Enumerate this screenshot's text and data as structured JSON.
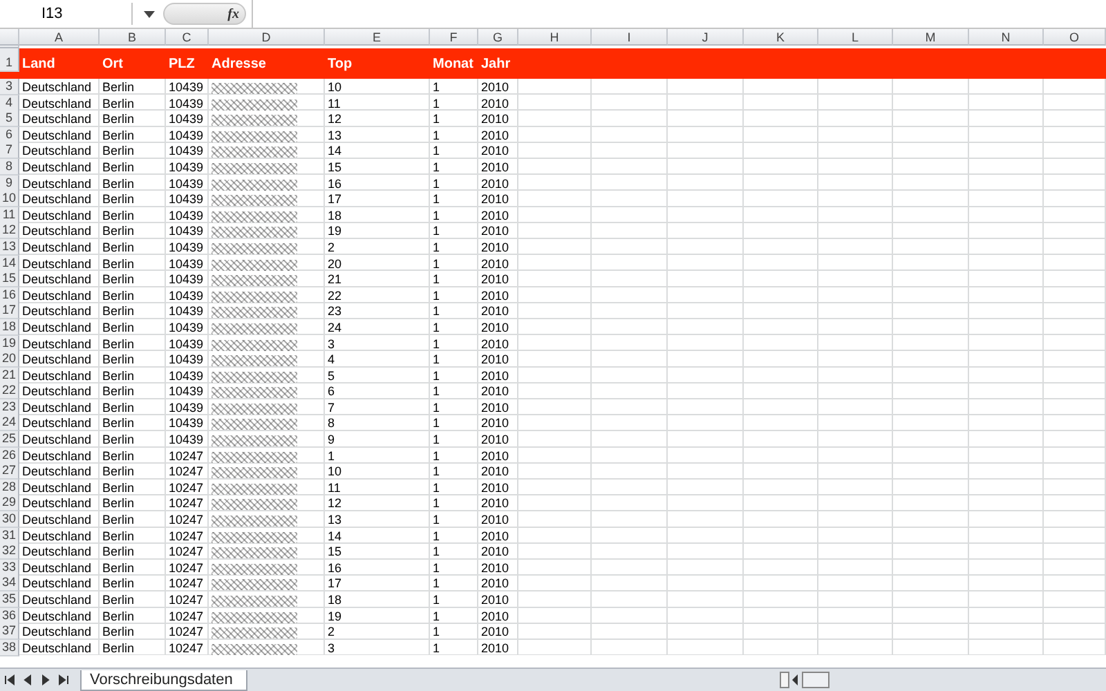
{
  "formula_bar": {
    "name_box": "I13",
    "function_label": "fx"
  },
  "columns": [
    "A",
    "B",
    "C",
    "D",
    "E",
    "F",
    "G",
    "H",
    "I",
    "J",
    "K",
    "L",
    "M",
    "N",
    "O"
  ],
  "header_row": {
    "row": "1",
    "cells": [
      "Land",
      "Ort",
      "PLZ",
      "Adresse",
      "Top",
      "Monat",
      "Jahr"
    ]
  },
  "rows": [
    {
      "row": "3",
      "cells": [
        "Deutschland",
        "Berlin",
        "10439",
        "10",
        "1",
        "2010"
      ]
    },
    {
      "row": "4",
      "cells": [
        "Deutschland",
        "Berlin",
        "10439",
        "11",
        "1",
        "2010"
      ]
    },
    {
      "row": "5",
      "cells": [
        "Deutschland",
        "Berlin",
        "10439",
        "12",
        "1",
        "2010"
      ]
    },
    {
      "row": "6",
      "cells": [
        "Deutschland",
        "Berlin",
        "10439",
        "13",
        "1",
        "2010"
      ]
    },
    {
      "row": "7",
      "cells": [
        "Deutschland",
        "Berlin",
        "10439",
        "14",
        "1",
        "2010"
      ]
    },
    {
      "row": "8",
      "cells": [
        "Deutschland",
        "Berlin",
        "10439",
        "15",
        "1",
        "2010"
      ]
    },
    {
      "row": "9",
      "cells": [
        "Deutschland",
        "Berlin",
        "10439",
        "16",
        "1",
        "2010"
      ]
    },
    {
      "row": "10",
      "cells": [
        "Deutschland",
        "Berlin",
        "10439",
        "17",
        "1",
        "2010"
      ]
    },
    {
      "row": "11",
      "cells": [
        "Deutschland",
        "Berlin",
        "10439",
        "18",
        "1",
        "2010"
      ]
    },
    {
      "row": "12",
      "cells": [
        "Deutschland",
        "Berlin",
        "10439",
        "19",
        "1",
        "2010"
      ]
    },
    {
      "row": "13",
      "cells": [
        "Deutschland",
        "Berlin",
        "10439",
        "2",
        "1",
        "2010"
      ]
    },
    {
      "row": "14",
      "cells": [
        "Deutschland",
        "Berlin",
        "10439",
        "20",
        "1",
        "2010"
      ]
    },
    {
      "row": "15",
      "cells": [
        "Deutschland",
        "Berlin",
        "10439",
        "21",
        "1",
        "2010"
      ]
    },
    {
      "row": "16",
      "cells": [
        "Deutschland",
        "Berlin",
        "10439",
        "22",
        "1",
        "2010"
      ]
    },
    {
      "row": "17",
      "cells": [
        "Deutschland",
        "Berlin",
        "10439",
        "23",
        "1",
        "2010"
      ]
    },
    {
      "row": "18",
      "cells": [
        "Deutschland",
        "Berlin",
        "10439",
        "24",
        "1",
        "2010"
      ]
    },
    {
      "row": "19",
      "cells": [
        "Deutschland",
        "Berlin",
        "10439",
        "3",
        "1",
        "2010"
      ]
    },
    {
      "row": "20",
      "cells": [
        "Deutschland",
        "Berlin",
        "10439",
        "4",
        "1",
        "2010"
      ]
    },
    {
      "row": "21",
      "cells": [
        "Deutschland",
        "Berlin",
        "10439",
        "5",
        "1",
        "2010"
      ]
    },
    {
      "row": "22",
      "cells": [
        "Deutschland",
        "Berlin",
        "10439",
        "6",
        "1",
        "2010"
      ]
    },
    {
      "row": "23",
      "cells": [
        "Deutschland",
        "Berlin",
        "10439",
        "7",
        "1",
        "2010"
      ]
    },
    {
      "row": "24",
      "cells": [
        "Deutschland",
        "Berlin",
        "10439",
        "8",
        "1",
        "2010"
      ]
    },
    {
      "row": "25",
      "cells": [
        "Deutschland",
        "Berlin",
        "10439",
        "9",
        "1",
        "2010"
      ]
    },
    {
      "row": "26",
      "cells": [
        "Deutschland",
        "Berlin",
        "10247",
        "1",
        "1",
        "2010"
      ]
    },
    {
      "row": "27",
      "cells": [
        "Deutschland",
        "Berlin",
        "10247",
        "10",
        "1",
        "2010"
      ]
    },
    {
      "row": "28",
      "cells": [
        "Deutschland",
        "Berlin",
        "10247",
        "11",
        "1",
        "2010"
      ]
    },
    {
      "row": "29",
      "cells": [
        "Deutschland",
        "Berlin",
        "10247",
        "12",
        "1",
        "2010"
      ]
    },
    {
      "row": "30",
      "cells": [
        "Deutschland",
        "Berlin",
        "10247",
        "13",
        "1",
        "2010"
      ]
    },
    {
      "row": "31",
      "cells": [
        "Deutschland",
        "Berlin",
        "10247",
        "14",
        "1",
        "2010"
      ]
    },
    {
      "row": "32",
      "cells": [
        "Deutschland",
        "Berlin",
        "10247",
        "15",
        "1",
        "2010"
      ]
    },
    {
      "row": "33",
      "cells": [
        "Deutschland",
        "Berlin",
        "10247",
        "16",
        "1",
        "2010"
      ]
    },
    {
      "row": "34",
      "cells": [
        "Deutschland",
        "Berlin",
        "10247",
        "17",
        "1",
        "2010"
      ]
    },
    {
      "row": "35",
      "cells": [
        "Deutschland",
        "Berlin",
        "10247",
        "18",
        "1",
        "2010"
      ]
    },
    {
      "row": "36",
      "cells": [
        "Deutschland",
        "Berlin",
        "10247",
        "19",
        "1",
        "2010"
      ]
    },
    {
      "row": "37",
      "cells": [
        "Deutschland",
        "Berlin",
        "10247",
        "2",
        "1",
        "2010"
      ]
    },
    {
      "row": "38",
      "cells": [
        "Deutschland",
        "Berlin",
        "10247",
        "3",
        "1",
        "2010"
      ]
    }
  ],
  "sheet_tabs": [
    {
      "label": "Vorschreibungsdaten",
      "selected": true
    }
  ]
}
